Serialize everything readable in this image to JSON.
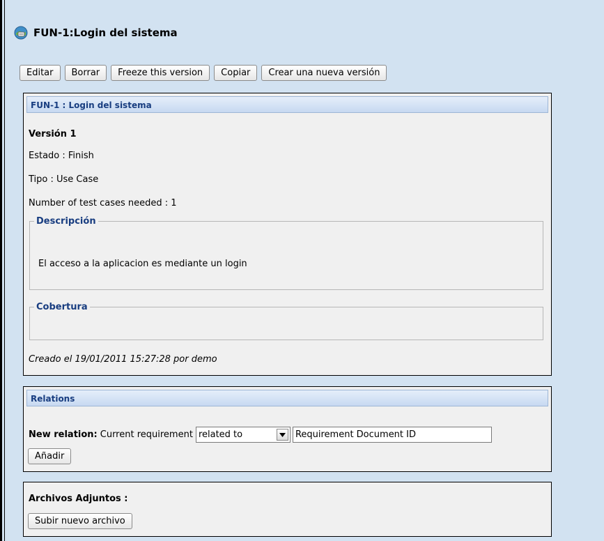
{
  "header": {
    "title": "FUN-1:Login del sistema"
  },
  "toolbar": {
    "edit_label": "Editar",
    "delete_label": "Borrar",
    "freeze_label": "Freeze this version",
    "copy_label": "Copiar",
    "new_version_label": "Crear una nueva versión"
  },
  "requirement": {
    "panel_title": "FUN-1 : Login del sistema",
    "version": "Versión 1",
    "status": "Estado : Finish",
    "type": "Tipo : Use Case",
    "test_cases": "Number of test cases needed : 1",
    "description_legend": "Descripción",
    "description_text": "El acceso a la aplicacion es mediante un login",
    "coverage_legend": "Cobertura",
    "created_info": "Creado el 19/01/2011 15:27:28  por demo"
  },
  "relations": {
    "panel_title": "Relations",
    "new_relation_label": "New relation:",
    "current_requirement_label": "Current requirement",
    "relation_type_selected": "related to",
    "doc_id_placeholder": "Requirement Document ID",
    "add_label": "Añadir"
  },
  "attachments": {
    "title": "Archivos Adjuntos :",
    "upload_label": "Subir nuevo archivo"
  },
  "colors": {
    "background": "#d2e2f1",
    "panel_background": "#f0f0f0",
    "section_title": "#183d80"
  }
}
